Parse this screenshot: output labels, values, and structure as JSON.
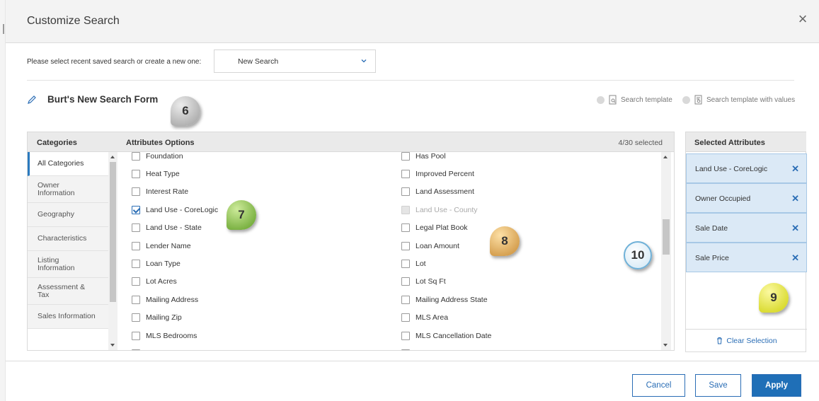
{
  "dialog": {
    "title": "Customize Search",
    "close_icon": "close-icon"
  },
  "saved_search": {
    "label": "Please select recent saved search or create a new one:",
    "selected": "New Search"
  },
  "form": {
    "name": "Burt's New Search Form",
    "template_option": "Search template",
    "template_values_option": "Search template with values"
  },
  "categories": {
    "header": "Categories",
    "items": [
      {
        "label": "All Categories",
        "active": true
      },
      {
        "label": "Owner\nInformation"
      },
      {
        "label": "Geography"
      },
      {
        "label": "Characteristics"
      },
      {
        "label": "Listing\nInformation"
      },
      {
        "label": "Assessment &\nTax"
      },
      {
        "label": "Sales Information"
      }
    ]
  },
  "attributes": {
    "header": "Attributes Options",
    "count": "4/30 selected",
    "left": [
      {
        "label": "Foundation",
        "checked": false
      },
      {
        "label": "Heat Type",
        "checked": false
      },
      {
        "label": "Interest Rate",
        "checked": false
      },
      {
        "label": "Land Use - CoreLogic",
        "checked": true
      },
      {
        "label": "Land Use - State",
        "checked": false
      },
      {
        "label": "Lender Name",
        "checked": false
      },
      {
        "label": "Loan Type",
        "checked": false
      },
      {
        "label": "Lot Acres",
        "checked": false
      },
      {
        "label": "Mailing Address",
        "checked": false
      },
      {
        "label": "Mailing Zip",
        "checked": false
      },
      {
        "label": "MLS Bedrooms",
        "checked": false
      },
      {
        "label": "",
        "checked": false
      }
    ],
    "right": [
      {
        "label": "Has Pool",
        "checked": false
      },
      {
        "label": "Improved Percent",
        "checked": false
      },
      {
        "label": "Land Assessment",
        "checked": false
      },
      {
        "label": "Land Use - County",
        "checked": false,
        "disabled": true
      },
      {
        "label": "Legal Plat Book",
        "checked": false
      },
      {
        "label": "Loan Amount",
        "checked": false
      },
      {
        "label": "Lot",
        "checked": false
      },
      {
        "label": "Lot Sq Ft",
        "checked": false
      },
      {
        "label": "Mailing Address State",
        "checked": false
      },
      {
        "label": "MLS Area",
        "checked": false
      },
      {
        "label": "MLS Cancellation Date",
        "checked": false
      },
      {
        "label": "",
        "checked": false
      }
    ]
  },
  "selected": {
    "header": "Selected Attributes",
    "items": [
      "Land Use - CoreLogic",
      "Owner Occupied",
      "Sale Date",
      "Sale Price"
    ],
    "clear_label": "Clear Selection"
  },
  "callouts": {
    "c6": "6",
    "c7": "7",
    "c8": "8",
    "c9": "9",
    "c10": "10"
  },
  "buttons": {
    "cancel": "Cancel",
    "save": "Save",
    "apply": "Apply"
  },
  "colors": {
    "accent": "#1f6fb7",
    "selected_bg": "#dbe9f6"
  }
}
